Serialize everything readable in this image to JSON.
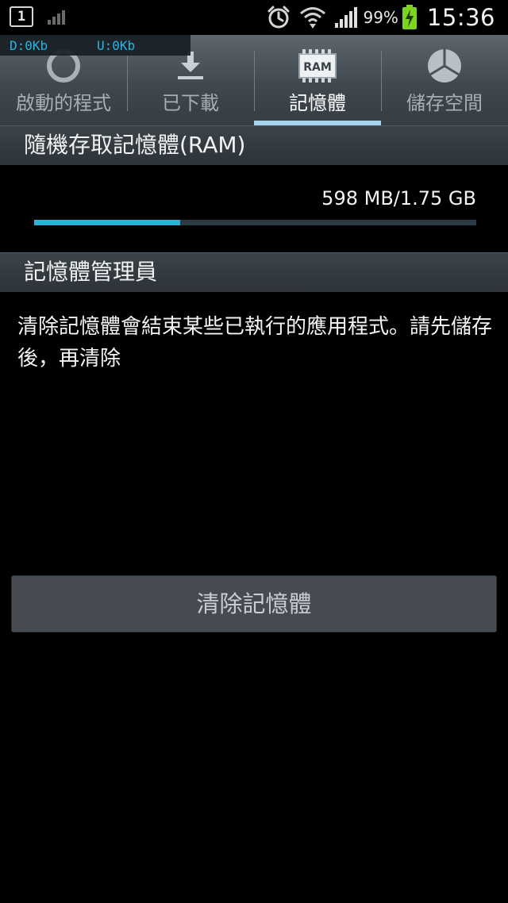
{
  "status_bar": {
    "notification_count": "1",
    "battery_percent": "99%",
    "time": "15:36",
    "icons": [
      "notification-box-icon",
      "signal-icon",
      "alarm-icon",
      "wifi-icon",
      "cell-signal-icon",
      "battery-charging-icon"
    ]
  },
  "speed_overlay": {
    "download": "D:0Kb",
    "upload": "U:0Kb"
  },
  "tabs": [
    {
      "label": "啟動的程式",
      "icon": "running-apps-icon",
      "active": false
    },
    {
      "label": "已下載",
      "icon": "download-icon",
      "active": false
    },
    {
      "label": "記憶體",
      "icon": "ram-icon",
      "icon_text": "RAM",
      "active": true
    },
    {
      "label": "儲存空間",
      "icon": "storage-pie-icon",
      "active": false
    }
  ],
  "ram": {
    "header": "隨機存取記憶體(RAM)",
    "usage_text": "598 MB/1.75 GB",
    "used_fraction": 0.33
  },
  "memory_manager": {
    "header": "記憶體管理員",
    "description": "清除記憶體會結束某些已執行的應用程式。請先儲存後，再清除",
    "button_label": "清除記憶體"
  },
  "colors": {
    "accent_blue": "#2eb0d9",
    "tab_indicator": "#a8d4ee",
    "speed_text": "#27b6e4",
    "battery_green": "#7ed321"
  }
}
